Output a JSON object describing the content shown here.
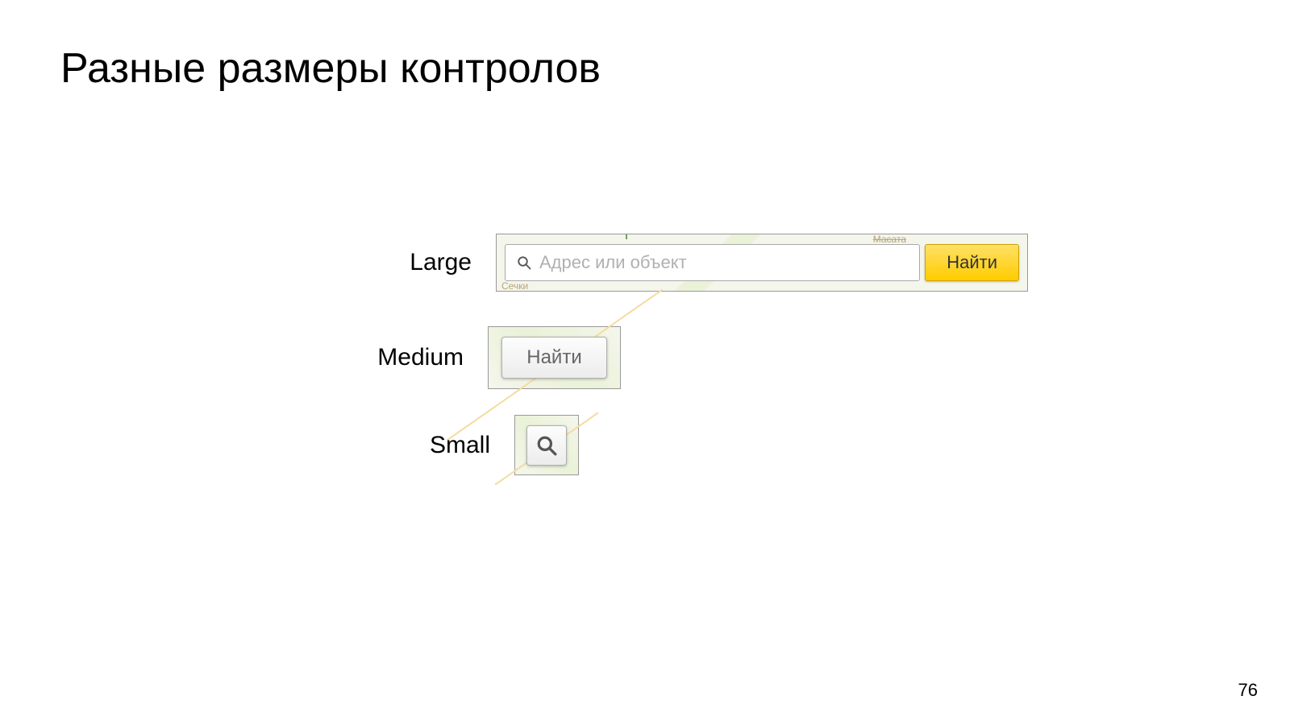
{
  "slide": {
    "title": "Разные размеры контролов",
    "page_number": "76"
  },
  "rows": {
    "large": {
      "label": "Large",
      "placeholder": "Адрес или объект",
      "button": "Найти",
      "bg_text_top": "Масата",
      "bg_text_bottom": "Сечки"
    },
    "medium": {
      "label": "Medium",
      "button": "Найти"
    },
    "small": {
      "label": "Small"
    }
  }
}
